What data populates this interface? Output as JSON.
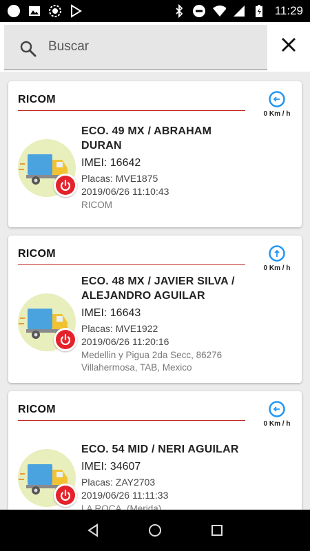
{
  "status_bar": {
    "time": "11:29"
  },
  "search": {
    "placeholder": "Buscar"
  },
  "vehicles": [
    {
      "group": "RICOM",
      "speed": "0 Km / h",
      "name": "ECO. 49 MX / ABRAHAM DURAN",
      "imei": "IMEI: 16642",
      "plate": "Placas: MVE1875",
      "datetime": "2019/06/26 11:10:43",
      "location": "RICOM",
      "heading_icon": "arrow-left-icon"
    },
    {
      "group": "RICOM",
      "speed": "0 Km / h",
      "name": "ECO. 48 MX / JAVIER SILVA / ALEJANDRO AGUILAR",
      "imei": "IMEI: 16643",
      "plate": "Placas: MVE1922",
      "datetime": "2019/06/26 11:20:16",
      "location": "Medellin y Pigua 2da Secc, 86276 Villahermosa, TAB, Mexico",
      "heading_icon": "arrow-up-icon"
    },
    {
      "group": "RICOM",
      "speed": "0 Km / h",
      "name": "ECO. 54 MID / NERI AGUILAR",
      "imei": "IMEI: 34607",
      "plate": "Placas: ZAY2703",
      "datetime": "2019/06/26 11:11:33",
      "location": "LA ROCA, (Merida)",
      "heading_icon": "arrow-left-icon"
    }
  ],
  "colors": {
    "accent_blue": "#2196f3",
    "rule_red": "#c0271f",
    "power_red": "#e3222b",
    "avatar_bg": "#e8eebc"
  }
}
